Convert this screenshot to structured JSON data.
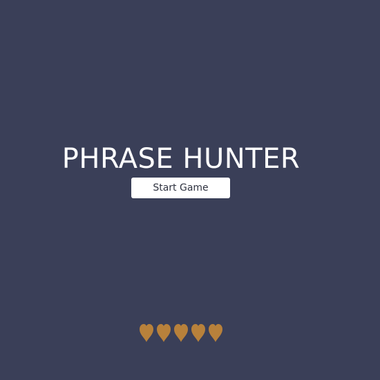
{
  "colors": {
    "background": "#3a3f58",
    "title_text": "#ffffff",
    "button_background": "#ffffff",
    "button_text": "#2f3340",
    "heart": "#b8813b"
  },
  "overlay": {
    "title": "PHRASE HUNTER",
    "start_button_label": "Start Game"
  },
  "scoreboard": {
    "icon": "heart-icon",
    "lives_remaining": 5,
    "lives_total": 5
  }
}
